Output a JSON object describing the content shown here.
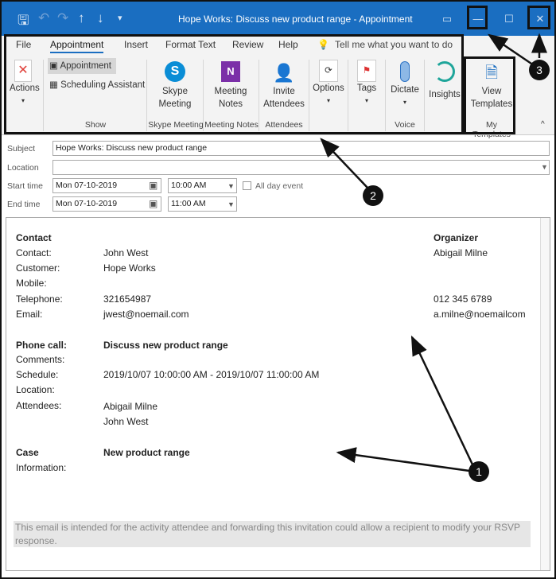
{
  "window": {
    "title": "Hope Works: Discuss new product range  -  Appointment",
    "min": "—",
    "max": "☐",
    "close": "✕"
  },
  "quick_access": {
    "save": "🖫",
    "undo": "↶",
    "redo": "↷",
    "up": "↑",
    "down": "↓",
    "more": "▾"
  },
  "ribbon": {
    "tabs": [
      {
        "label": "File"
      },
      {
        "label": "Appointment",
        "active": true
      },
      {
        "label": "Insert"
      },
      {
        "label": "Format Text"
      },
      {
        "label": "Review"
      },
      {
        "label": "Help"
      }
    ],
    "tell_me": "Tell me what you want to do",
    "actions": "Actions",
    "show": {
      "appointment": "Appointment",
      "scheduling": "Scheduling Assistant",
      "group": "Show"
    },
    "skype": {
      "label1": "Skype",
      "label2": "Meeting",
      "group": "Skype Meeting"
    },
    "notes": {
      "label1": "Meeting",
      "label2": "Notes",
      "group": "Meeting Notes"
    },
    "invite": {
      "label1": "Invite",
      "label2": "Attendees",
      "group": "Attendees"
    },
    "options": "Options",
    "tags": "Tags",
    "dictate": "Dictate",
    "voice_group": "Voice",
    "insights": "Insights",
    "templates": {
      "label1": "View",
      "label2": "Templates",
      "group": "My Templates"
    },
    "collapse": "^"
  },
  "form": {
    "subject_label": "Subject",
    "subject": "Hope Works: Discuss new product range",
    "location_label": "Location",
    "location": "",
    "start_label": "Start time",
    "start_date": "Mon 07-10-2019",
    "start_time": "10:00 AM",
    "all_day": "All day event",
    "all_day_checked": false,
    "end_label": "End time",
    "end_date": "Mon 07-10-2019",
    "end_time": "11:00 AM"
  },
  "content": {
    "contact_h": "Contact",
    "contact_l": "Contact:",
    "contact_v": "John West",
    "customer_l": "Customer:",
    "customer_v": "Hope Works",
    "mobile_l": "Mobile:",
    "tel_l": "Telephone:",
    "tel_v": "321654987",
    "email_l": "Email:",
    "email_v": "jwest@noemail.com",
    "org_h": "Organizer",
    "org_v": "Abigail Milne",
    "org_tel": "012 345 6789",
    "org_email": "a.milne@noemailcom",
    "call_l": "Phone call:",
    "call_v": "Discuss new product range",
    "comments_l": "Comments:",
    "schedule_l": "Schedule:",
    "schedule_v": "2019/10/07 10:00:00 AM - 2019/10/07 11:00:00 AM",
    "location_l": "Location:",
    "attendees_l": "Attendees:",
    "att1": "Abigail Milne",
    "att2": "John West",
    "case_l": "Case",
    "case_v": "New product range",
    "info_l": "Information:",
    "footer": "This email is intended for the activity attendee and forwarding this invitation could allow a recipient to modify your RSVP response."
  },
  "callouts": [
    "1",
    "2",
    "3"
  ]
}
